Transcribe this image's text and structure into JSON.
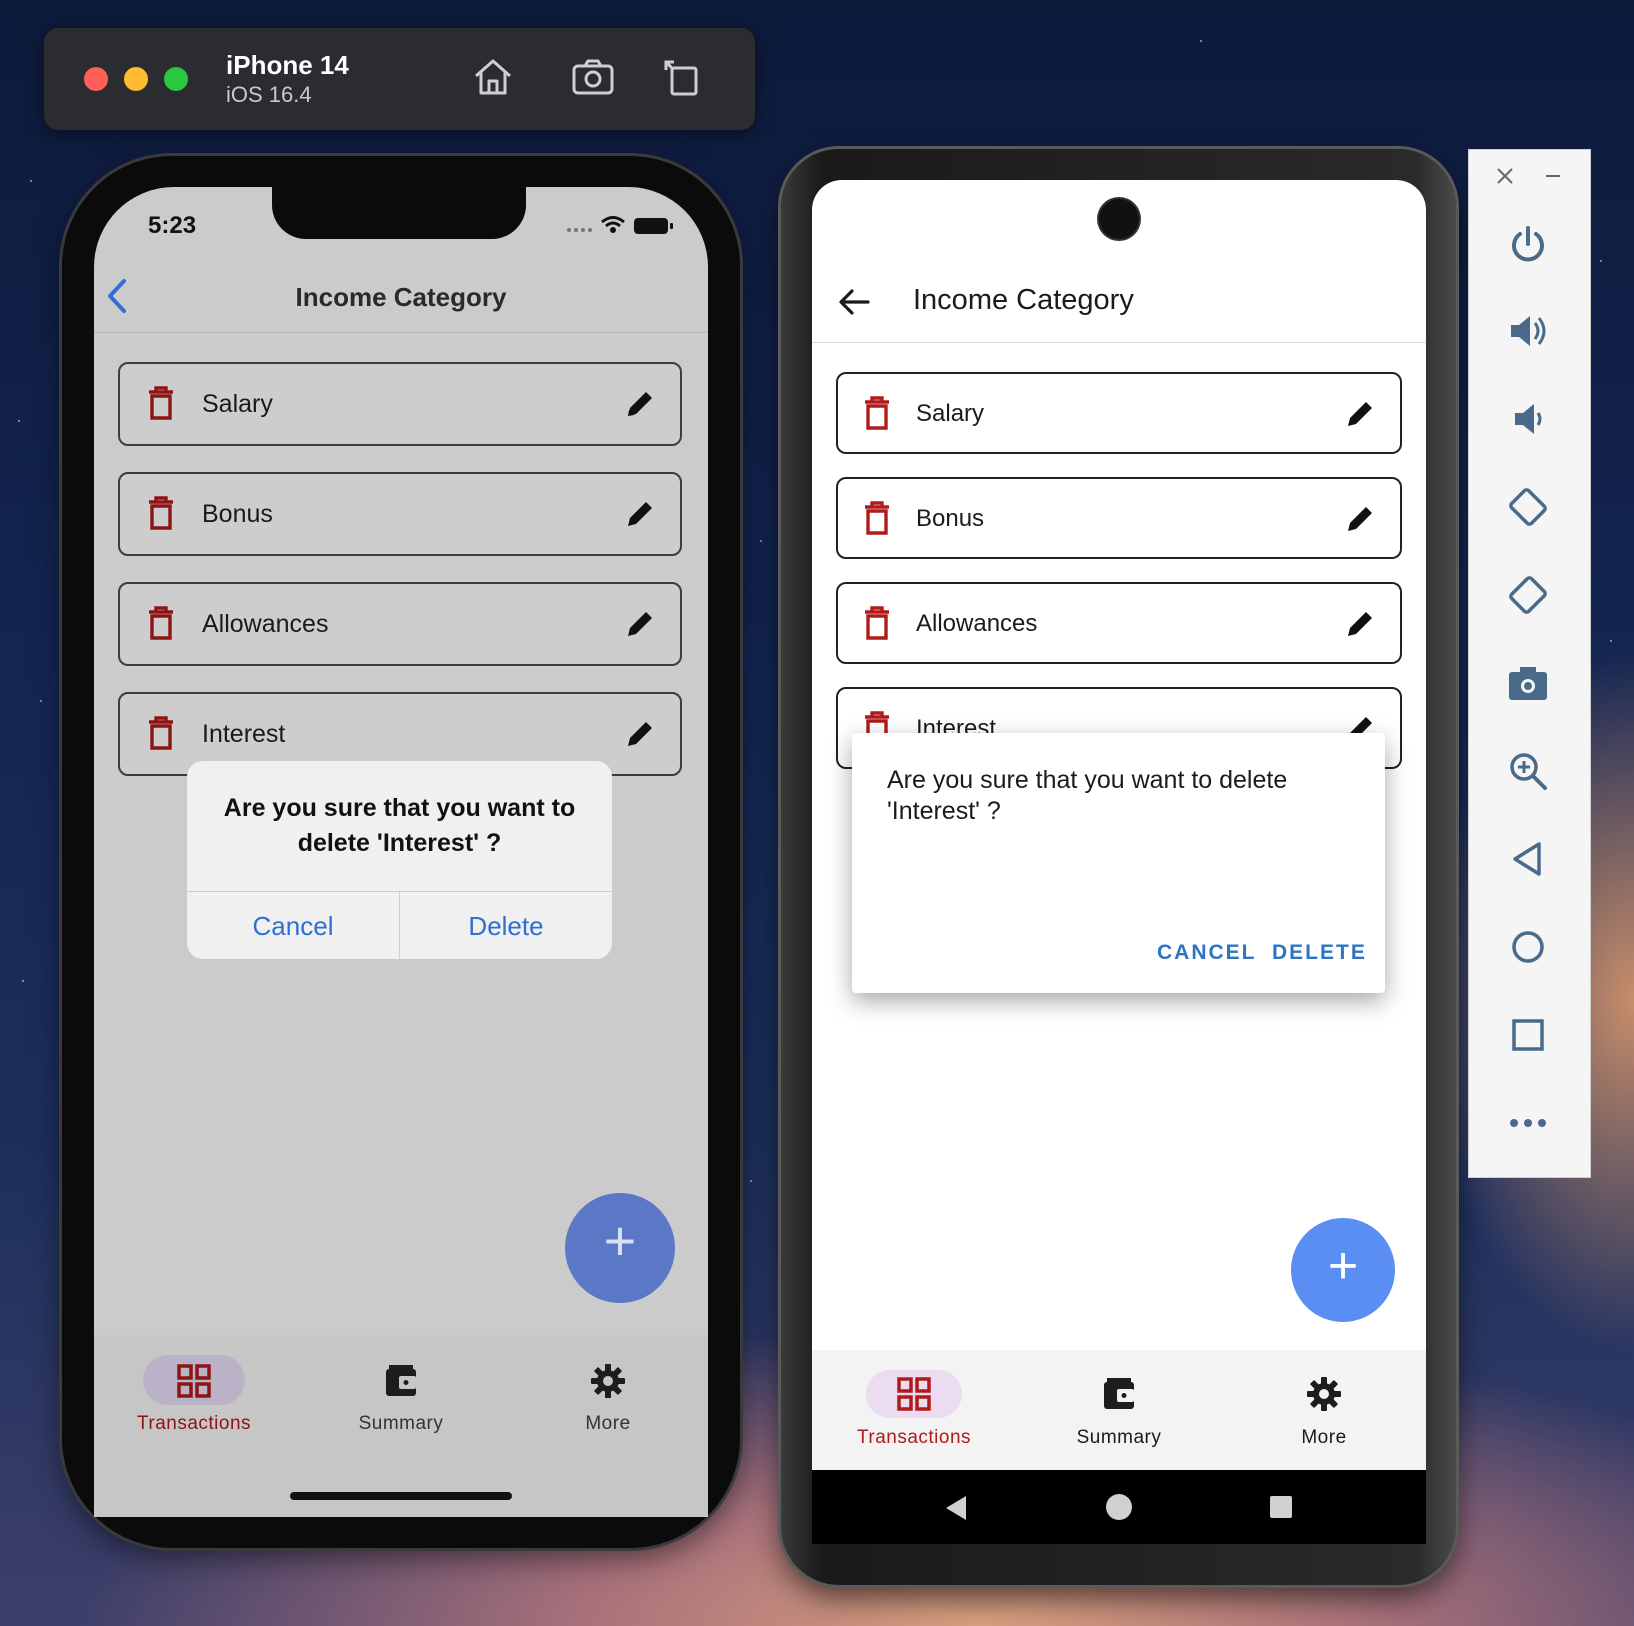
{
  "simulator": {
    "device_name": "iPhone 14",
    "os_version": "iOS 16.4",
    "traffic_lights": {
      "close": "#ff5f57",
      "minimize": "#febc2e",
      "zoom": "#28c840"
    },
    "tools": [
      "home-icon",
      "screenshot-icon",
      "rotate-icon"
    ]
  },
  "ios": {
    "status_time": "5:23",
    "title": "Income Category",
    "categories": [
      "Salary",
      "Bonus",
      "Allowances",
      "Interest"
    ],
    "dialog": {
      "message": "Are you sure that you want to delete 'Interest' ?",
      "cancel": "Cancel",
      "delete": "Delete"
    },
    "nav": {
      "transactions": "Transactions",
      "summary": "Summary",
      "more": "More"
    },
    "fab_symbol": "+"
  },
  "android": {
    "title": "Income Category",
    "categories": [
      "Salary",
      "Bonus",
      "Allowances",
      "Interest"
    ],
    "dialog": {
      "message": "Are you sure that you want to delete 'Interest' ?",
      "cancel": "CANCEL",
      "delete": "DELETE"
    },
    "nav": {
      "transactions": "Transactions",
      "summary": "Summary",
      "more": "More"
    },
    "fab_symbol": "+"
  },
  "emulator_toolbar": {
    "tools": [
      "close-icon",
      "minimize-icon",
      "power-icon",
      "volume-up-icon",
      "volume-down-icon",
      "rotate-left-icon",
      "rotate-right-icon",
      "camera-icon",
      "zoom-icon",
      "back-icon",
      "home-icon",
      "overview-icon",
      "more-icon"
    ]
  },
  "colors": {
    "trash_red": "#8e1414",
    "active_nav_red": "#8e1414",
    "ios_link_blue": "#2f6fd4",
    "android_button_blue": "#2f74c0",
    "ios_fab": "#5a78c5",
    "android_fab": "#5b8ef2"
  }
}
